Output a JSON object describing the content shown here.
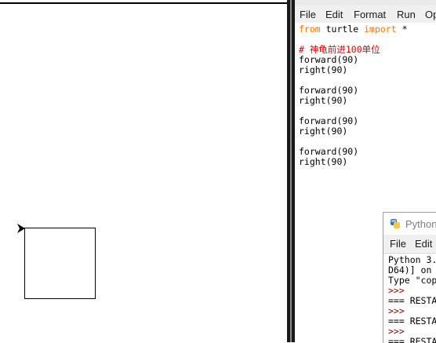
{
  "editor": {
    "menu": [
      "File",
      "Edit",
      "Format",
      "Run",
      "Op"
    ],
    "code": [
      {
        "kw": "from",
        "text": " turtle ",
        "kw2": "import",
        "text2": " *"
      },
      {
        "comment": ""
      },
      {
        "comment": "# 神龟前进100单位"
      },
      {
        "text": "forward(90)"
      },
      {
        "text": "right(90)"
      },
      {
        "text": ""
      },
      {
        "text": "forward(90)"
      },
      {
        "text": "right(90)"
      },
      {
        "text": ""
      },
      {
        "text": "forward(90)"
      },
      {
        "text": "right(90)"
      },
      {
        "text": ""
      },
      {
        "text": "forward(90)"
      },
      {
        "text": "right(90)"
      }
    ]
  },
  "shell": {
    "title": "Python",
    "menu": [
      "File",
      "Edit"
    ],
    "lines": [
      {
        "text": "Python 3."
      },
      {
        "text": "D64)] on"
      },
      {
        "text": "Type \"cop"
      },
      {
        "prompt": ">>>"
      },
      {
        "text": "=== RESTA"
      },
      {
        "prompt": ">>>"
      },
      {
        "text": "=== RESTA"
      },
      {
        "prompt": ">>>"
      },
      {
        "text": "=== RESTA"
      }
    ]
  },
  "colors": {
    "keyword": "#ff7700",
    "comment": "#dd0000",
    "prompt": "#8b0000"
  }
}
